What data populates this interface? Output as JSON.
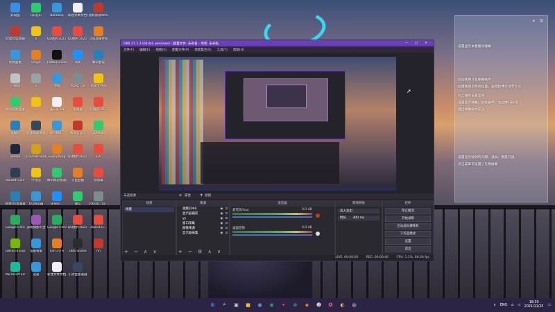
{
  "desktop_icons": [
    {
      "label": "此电脑",
      "color": "#3a8ee6"
    },
    {
      "label": "QQ音乐",
      "color": "#2ecc71"
    },
    {
      "label": "Bandizip",
      "color": "#3498db"
    },
    {
      "label": "新建文本文档(2).txt",
      "color": "#f0f0f0"
    },
    {
      "label": "鼠标加速WeGame组件",
      "color": "#c0392b"
    },
    {
      "label": "哔哩哔哩直播姬",
      "color": "#c0392b"
    },
    {
      "label": "0",
      "color": "#f1c40f"
    },
    {
      "label": "QQ图片20211...",
      "color": "#e74c3c"
    },
    {
      "label": "QQ图片20211...",
      "color": "#e74c3c"
    },
    {
      "label": "斗鱼直播伴侣",
      "color": "#e67e22"
    },
    {
      "label": "控制面板",
      "color": "#3498db"
    },
    {
      "label": "Origin",
      "color": "#e67e22"
    },
    {
      "label": "Fast&Furious",
      "color": "#111111"
    },
    {
      "label": "B站",
      "color": "#1e90ff"
    },
    {
      "label": "腾讯会议",
      "color": "#2980b9"
    },
    {
      "label": "回收站",
      "color": "#bdc3c7"
    },
    {
      "label": "2",
      "color": "#95a5a6"
    },
    {
      "label": "手机",
      "color": "#3498db"
    },
    {
      "label": "YUAOT10",
      "color": "#7f8c8d"
    },
    {
      "label": "新建文件夹",
      "color": "#f1c40f"
    },
    {
      "label": "腾讯视频直播",
      "color": "#2ecc71"
    },
    {
      "label": "1",
      "color": "#f1c40f"
    },
    {
      "label": "通天班.txt",
      "color": "#f0f0f0"
    },
    {
      "label": "加速器",
      "color": "#e74c3c"
    },
    {
      "label": "QQ图片20211117...",
      "color": "#e74c3c"
    },
    {
      "label": "俄剧院",
      "color": "#2980b9"
    },
    {
      "label": "新建网速测速",
      "color": "#34495e"
    },
    {
      "label": "vs—btn...",
      "color": "#3498db"
    },
    {
      "label": "网易云音乐",
      "color": "#c0392b"
    },
    {
      "label": "QQMusic",
      "color": "#2ecc71"
    },
    {
      "label": "Steam",
      "color": "#1b2838"
    },
    {
      "label": "Counter-Strike Global Off...",
      "color": "#d4a017"
    },
    {
      "label": "Everything",
      "color": "#e67e22"
    },
    {
      "label": "QQ图片20211...",
      "color": "#e74c3c"
    },
    {
      "label": "EA",
      "color": "#e74c3c"
    },
    {
      "label": "Ubisoft Connect",
      "color": "#2c3e50"
    },
    {
      "label": "YY语音",
      "color": "#f1c40f"
    },
    {
      "label": "腾讯网游加速器",
      "color": "#2ecc71"
    },
    {
      "label": "斗鱼直播",
      "color": "#e67e22"
    },
    {
      "label": "快剪辑",
      "color": "#e74c3c"
    },
    {
      "label": "网易UU加速器",
      "color": "#2980b9"
    },
    {
      "label": "QQ浏览器",
      "color": "#3498db"
    },
    {
      "label": "Bilibili...",
      "color": "#1e90ff"
    },
    {
      "label": "微信",
      "color": "#2ecc71"
    },
    {
      "label": "cc6c817ac...",
      "color": "#7f8c8d"
    },
    {
      "label": "Google Chrome",
      "color": "#27ae60"
    },
    {
      "label": "游戏加加平台",
      "color": "#9b59b6"
    },
    {
      "label": "Google Chrome",
      "color": "#27ae60"
    },
    {
      "label": "QQ图片20211116...",
      "color": "#e74c3c"
    },
    {
      "label": "2021031...",
      "color": "#e74c3c"
    },
    {
      "label": "GeForce Experience",
      "color": "#76b900"
    },
    {
      "label": "电脑管家",
      "color": "#3498db"
    },
    {
      "label": "Far Cry 6",
      "color": "#e67e22"
    },
    {
      "label": "OBS Studio",
      "color": "#2c2c2c"
    },
    {
      "label": "nn",
      "color": "#c0392b"
    },
    {
      "label": "Microsoft Edge",
      "color": "#1abc9c"
    },
    {
      "label": "迅雷",
      "color": "#3498db"
    },
    {
      "label": "新建文本文档.txt",
      "color": "#f0f0f0"
    },
    {
      "label": "小黑盒加速器",
      "color": "#34495e"
    }
  ],
  "obs": {
    "title": "OBS 27.1.3 (64-bit, windows) - 配置文件: 未命名 - 场景: 未命名",
    "menu": [
      "文件(F)",
      "编辑(E)",
      "视图(V)",
      "配置文件(P)",
      "场景集合(S)",
      "工具(T)",
      "帮助(H)"
    ],
    "no_source": "未选择源",
    "props_btn": "属性",
    "filters_btn": "滤镜",
    "docks": {
      "scenes": {
        "title": "场景",
        "items": [
          "场景"
        ]
      },
      "sources": {
        "title": "来源",
        "items": [
          "视频2060",
          "显示器捕获",
          "yy",
          "窗口采集",
          "图像来源",
          "显示器采集"
        ]
      },
      "mixer": {
        "title": "混音器",
        "channels": [
          {
            "name": "麦克风/Aux",
            "level": "0.0 dB"
          },
          {
            "name": "桌面音频",
            "level": "0.0 dB"
          }
        ]
      },
      "transitions": {
        "title": "转场特效",
        "type": "淡入淡出",
        "duration_label": "时长",
        "duration": "300 ms"
      },
      "controls": {
        "title": "控件",
        "buttons": [
          "停止推流",
          "开始录制",
          "启动虚拟摄像机",
          "工作室模式",
          "设置",
          "退出"
        ]
      }
    },
    "status": {
      "live": "LIVE: 00:00:00",
      "rec": "REC: 00:00:00",
      "cpu": "CPU: 1.1%, 60.00 fps"
    }
  },
  "panel": {
    "line1": "设置显示本直播间弹幕",
    "line2": "欢迎使用斗鱼弹幕助手",
    "line3": "左键拖拽可移动位置，右键拉伸可调节大小",
    "line4": "右上角有设置菜单",
    "line5": "设置提示弹幕，鼠标悬停，右边弹开按钮",
    "line6": "退出弹幕助手成功",
    "line7": "设置显示收到的礼物、道具、贵族开通",
    "line8": "点击菜单可设置小礼物屏蔽"
  },
  "taskbar": {
    "apps": [
      {
        "name": "start-icon",
        "glyph": "⊞",
        "color": "#4aa3ff"
      },
      {
        "name": "search-icon",
        "glyph": "⌕",
        "color": "#ffffff"
      },
      {
        "name": "task-view-icon",
        "glyph": "▣",
        "color": "#d0d0d0"
      },
      {
        "name": "explorer-icon",
        "glyph": "■",
        "color": "#f1c40f"
      },
      {
        "name": "steam-icon",
        "glyph": "●",
        "color": "#4f8fc9"
      },
      {
        "name": "chrome-icon",
        "glyph": "◉",
        "color": "#27ae60"
      },
      {
        "name": "game-icon",
        "glyph": "✦",
        "color": "#e74c3c"
      },
      {
        "name": "xbox-icon",
        "glyph": "⊗",
        "color": "#2ecc71"
      },
      {
        "name": "app-icon",
        "glyph": "◆",
        "color": "#e67e22"
      },
      {
        "name": "mask-icon",
        "glyph": "☻",
        "color": "#dcdcdc"
      },
      {
        "name": "app2-icon",
        "glyph": "✪",
        "color": "#ff7aa2"
      },
      {
        "name": "douyu-icon",
        "glyph": "◐",
        "color": "#ffb74d"
      },
      {
        "name": "obs-icon",
        "glyph": "◎",
        "color": "#ffffff"
      }
    ],
    "tray": {
      "lang": "ENG",
      "time": "18:30",
      "date": "2021/11/25"
    }
  }
}
